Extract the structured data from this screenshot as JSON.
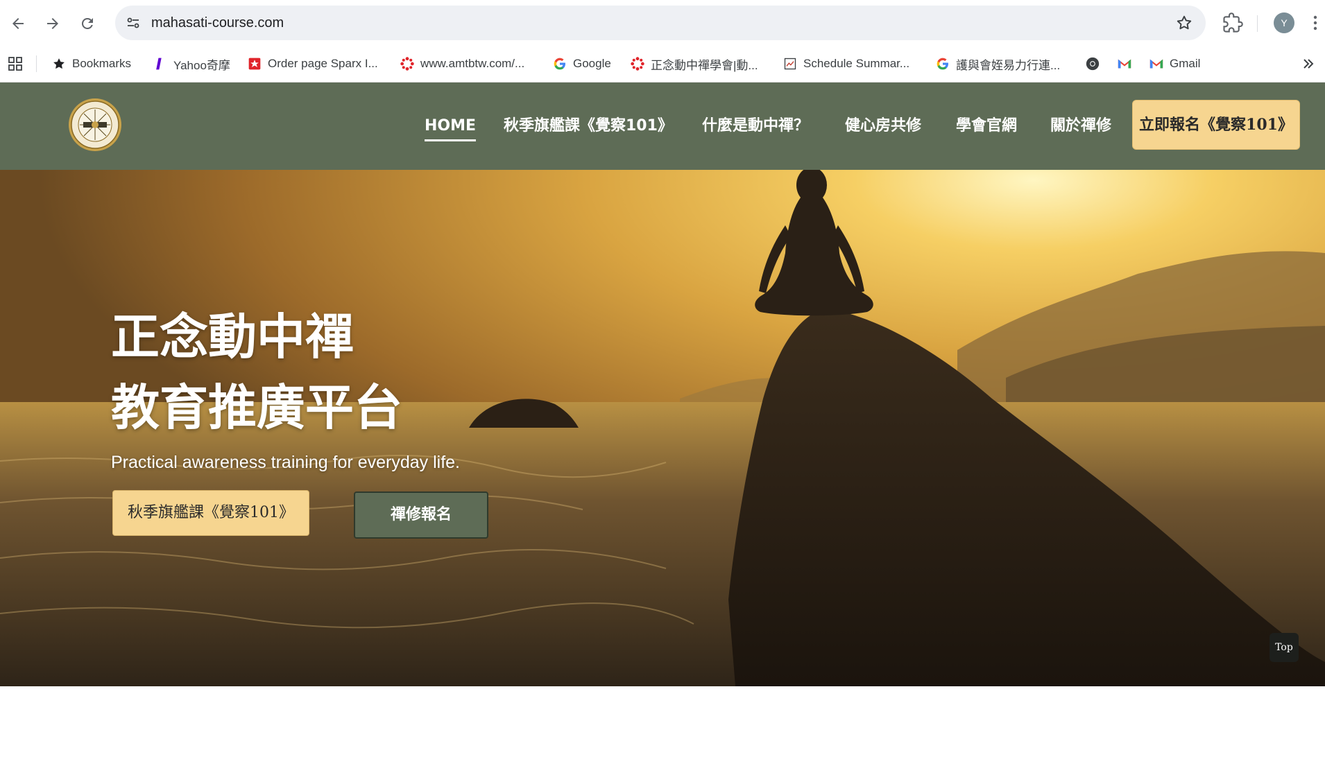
{
  "browser": {
    "url": "mahasati-course.com",
    "avatar_letter": "Y",
    "bookmarks": [
      {
        "label": "Bookmarks",
        "icon": "star-icon"
      },
      {
        "label": "Yahoo奇摩",
        "icon": "yahoo-icon"
      },
      {
        "label": "Order page Sparx I...",
        "icon": "sparx-icon"
      },
      {
        "label": "www.amtbtw.com/...",
        "icon": "amtb-icon"
      },
      {
        "label": "Google",
        "icon": "google-icon"
      },
      {
        "label": "正念動中禪學會|動...",
        "icon": "mahasati-icon"
      },
      {
        "label": "Schedule Summar...",
        "icon": "schedule-icon"
      },
      {
        "label": "護與會姪易力行連...",
        "icon": "google-icon"
      },
      {
        "label": "",
        "icon": "chromium-icon"
      },
      {
        "label": "",
        "icon": "gmail-icon"
      },
      {
        "label": "Gmail",
        "icon": "gmail-icon"
      }
    ]
  },
  "site": {
    "nav": [
      {
        "label": "HOME",
        "active": true
      },
      {
        "label": "秋季旗艦課《覺察101》"
      },
      {
        "label": "什麼是動中禪？"
      },
      {
        "label": "健心房共修"
      },
      {
        "label": "學會官網"
      },
      {
        "label": "關於禪修"
      }
    ],
    "cta_label": "立即報名《覺察101》"
  },
  "hero": {
    "title_line1": "正念動中禪",
    "title_line2": "教育推廣平台",
    "subtitle": "Practical awareness training for everyday life.",
    "primary_button": "秋季旗艦課《覺察101》",
    "secondary_button": "禪修報名",
    "top_button": "Top"
  },
  "colors": {
    "header_bg": "#5e6c56",
    "accent_gold": "#f6d590",
    "omnibox_bg": "#eef0f4"
  }
}
